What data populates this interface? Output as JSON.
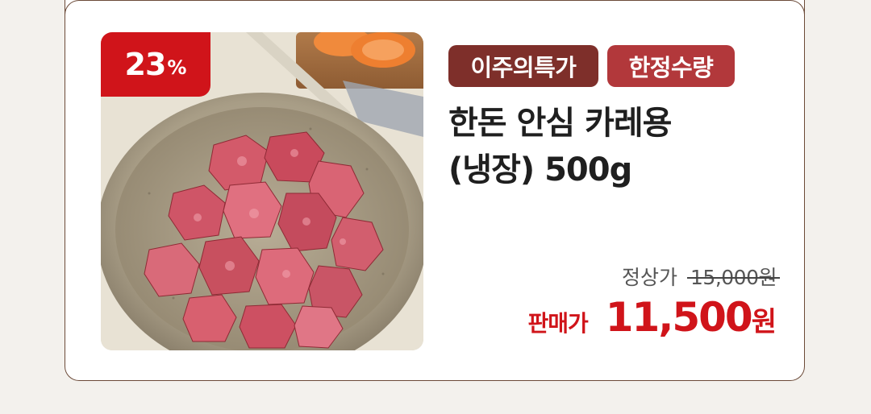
{
  "product": {
    "discount": {
      "value": "23",
      "unit": "%"
    },
    "tags": [
      {
        "label": "이주의특가",
        "color": "#7e2f2a"
      },
      {
        "label": "한정수량",
        "color": "#b2383b"
      }
    ],
    "title_lines": [
      "한돈 안심 카레용",
      "(냉장) 500g"
    ],
    "regular_price": {
      "label": "정상가",
      "value": "15,000원"
    },
    "sale_price": {
      "label": "판매가",
      "amount": "11,500",
      "currency": "원"
    },
    "image": {
      "icon": "meat-bowl-photo"
    }
  },
  "colors": {
    "accent_red": "#d0141a",
    "card_border": "#6b4a38",
    "background": "#f3f1ed"
  }
}
